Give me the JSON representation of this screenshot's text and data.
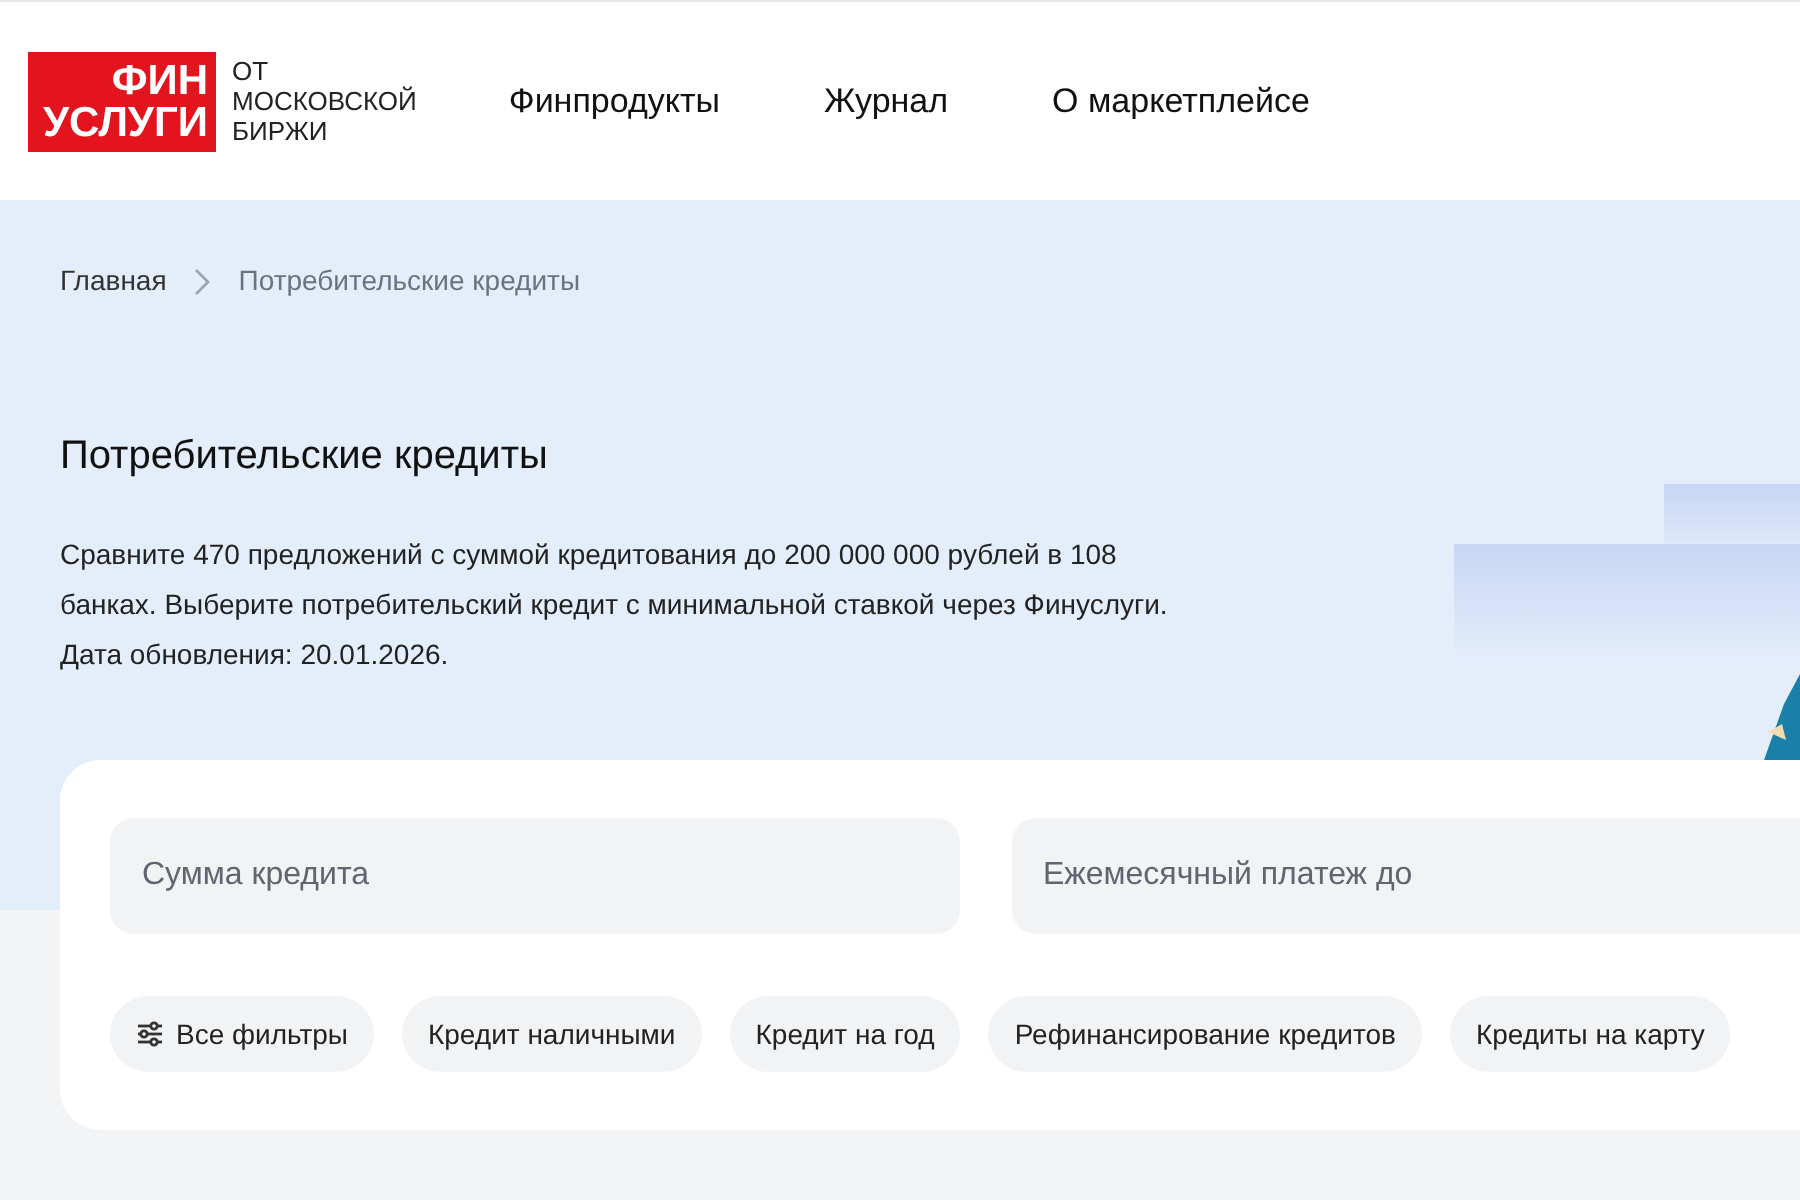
{
  "logo": {
    "line_1": "ФИН",
    "line_2": "УСЛУГИ",
    "tagline": [
      "ОТ",
      "МОСКОВСКОЙ",
      "БИРЖИ"
    ]
  },
  "nav": [
    "Финпродукты",
    "Журнал",
    "О маркетплейсе"
  ],
  "breadcrumbs": [
    "Главная",
    "Потребительские кредиты"
  ],
  "title": "Потребительские кредиты",
  "description": "Сравните 470 предложений с суммой кредитования до 200 000 000 рублей в 108 банках. Выберите потребительский кредит с минимальной ставкой через Финуслуги. Дата обновления: 20.01.2026.",
  "fields": [
    {
      "placeholder": "Сумма кредита"
    },
    {
      "placeholder": "Ежемесячный платеж до"
    }
  ],
  "chips": [
    {
      "kind": "filter",
      "label": "Все фильтры"
    },
    {
      "kind": "tag",
      "label": "Кредит наличными"
    },
    {
      "kind": "tag",
      "label": "Кредит на год"
    },
    {
      "kind": "tag",
      "label": "Рефинансирование кредитов"
    },
    {
      "kind": "tag",
      "label": "Кредиты на карту"
    }
  ]
}
